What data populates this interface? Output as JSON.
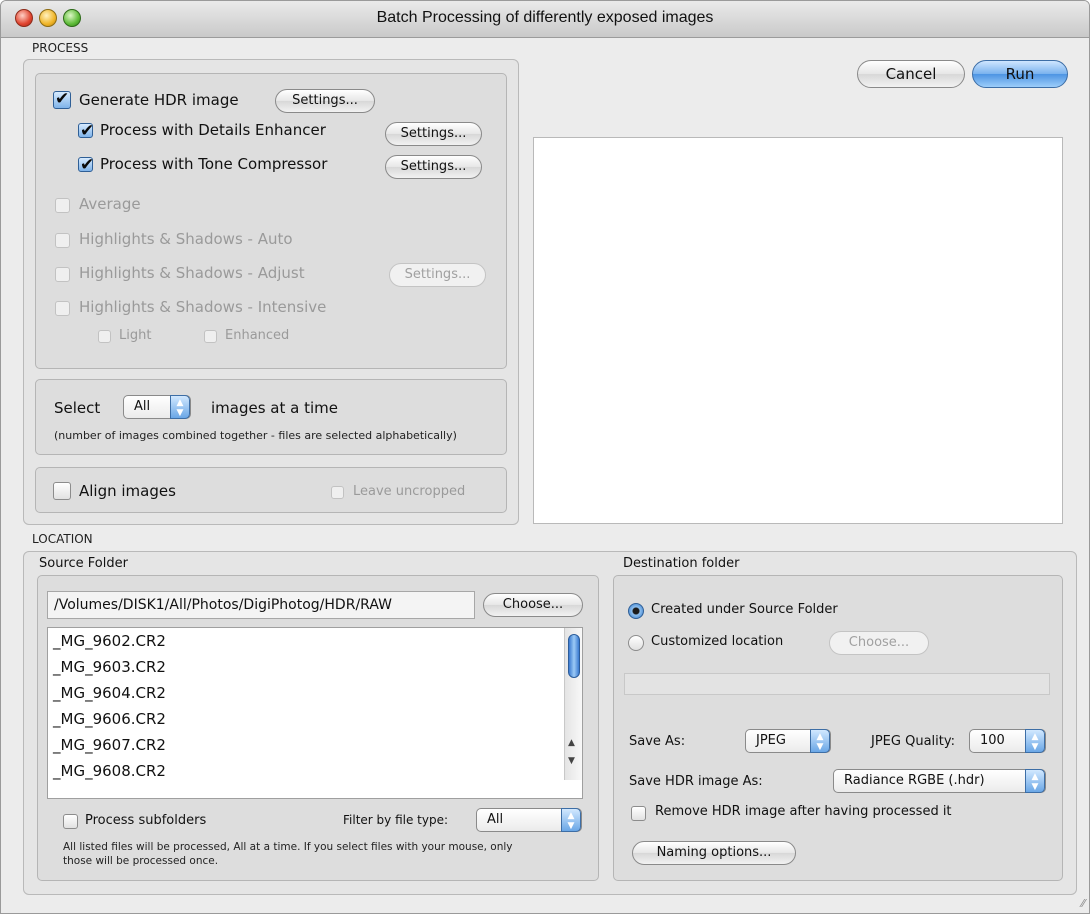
{
  "window": {
    "title": "Batch Processing of differently exposed images"
  },
  "process": {
    "section_label": "PROCESS",
    "generate_hdr": {
      "label": "Generate HDR image",
      "checked": true,
      "settings_label": "Settings..."
    },
    "details_enhancer": {
      "label": "Process with Details Enhancer",
      "checked": true,
      "settings_label": "Settings..."
    },
    "tone_compressor": {
      "label": "Process with Tone Compressor",
      "checked": true,
      "settings_label": "Settings..."
    },
    "average": {
      "label": "Average",
      "enabled": false
    },
    "hs_auto": {
      "label": "Highlights & Shadows - Auto",
      "enabled": false
    },
    "hs_adjust": {
      "label": "Highlights & Shadows - Adjust",
      "enabled": false,
      "settings_label": "Settings..."
    },
    "hs_intensive": {
      "label": "Highlights & Shadows - Intensive",
      "enabled": false
    },
    "light": {
      "label": "Light",
      "enabled": false
    },
    "enhanced": {
      "label": "Enhanced",
      "enabled": false
    },
    "select": {
      "prefix": "Select",
      "value": "All",
      "suffix": "images at a time",
      "note": "(number of images combined together - files are selected alphabetically)"
    },
    "align": {
      "label": "Align images",
      "checked": false,
      "leave_uncropped": "Leave uncropped"
    }
  },
  "actions": {
    "cancel": "Cancel",
    "run": "Run"
  },
  "location": {
    "section_label": "LOCATION",
    "source": {
      "title": "Source Folder",
      "path": "/Volumes/DISK1/All/Photos/DigiPhotog/HDR/RAW",
      "choose": "Choose...",
      "files": [
        "_MG_9602.CR2",
        "_MG_9603.CR2",
        "_MG_9604.CR2",
        "_MG_9606.CR2",
        "_MG_9607.CR2",
        "_MG_9608.CR2"
      ],
      "process_subfolders": "Process subfolders",
      "filter_label": "Filter by file type:",
      "filter_value": "All",
      "note_line1": "All listed files will be processed, All at a time. If you select files with your mouse, only",
      "note_line2": "those will be processed once."
    },
    "destination": {
      "title": "Destination folder",
      "created_under": "Created under Source Folder",
      "customized": "Customized location",
      "choose": "Choose...",
      "custom_path": "",
      "save_as_label": "Save As:",
      "save_as_value": "JPEG",
      "jpeg_quality_label": "JPEG Quality:",
      "jpeg_quality_value": "100",
      "save_hdr_label": "Save HDR image As:",
      "save_hdr_value": "Radiance RGBE (.hdr)",
      "remove_hdr": "Remove HDR image after having processed it",
      "naming_options": "Naming options..."
    }
  }
}
